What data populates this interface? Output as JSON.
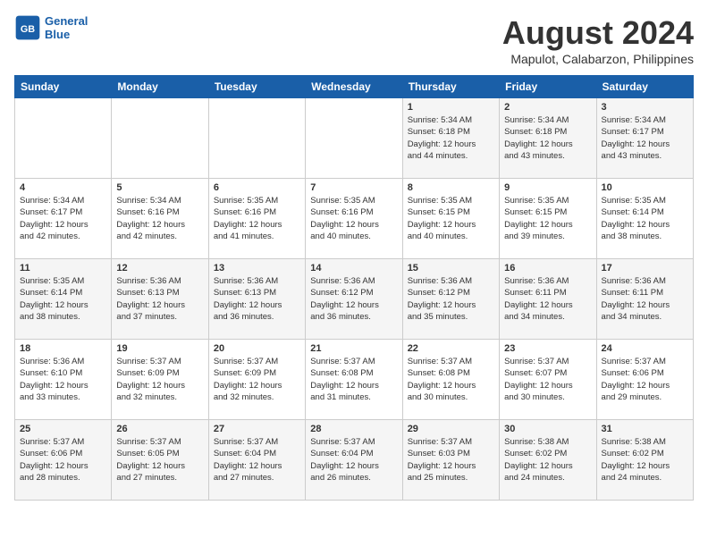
{
  "header": {
    "logo_line1": "General",
    "logo_line2": "Blue",
    "month_title": "August 2024",
    "location": "Mapulot, Calabarzon, Philippines"
  },
  "days_of_week": [
    "Sunday",
    "Monday",
    "Tuesday",
    "Wednesday",
    "Thursday",
    "Friday",
    "Saturday"
  ],
  "weeks": [
    [
      {
        "day": "",
        "text": ""
      },
      {
        "day": "",
        "text": ""
      },
      {
        "day": "",
        "text": ""
      },
      {
        "day": "",
        "text": ""
      },
      {
        "day": "1",
        "text": "Sunrise: 5:34 AM\nSunset: 6:18 PM\nDaylight: 12 hours\nand 44 minutes."
      },
      {
        "day": "2",
        "text": "Sunrise: 5:34 AM\nSunset: 6:18 PM\nDaylight: 12 hours\nand 43 minutes."
      },
      {
        "day": "3",
        "text": "Sunrise: 5:34 AM\nSunset: 6:17 PM\nDaylight: 12 hours\nand 43 minutes."
      }
    ],
    [
      {
        "day": "4",
        "text": "Sunrise: 5:34 AM\nSunset: 6:17 PM\nDaylight: 12 hours\nand 42 minutes."
      },
      {
        "day": "5",
        "text": "Sunrise: 5:34 AM\nSunset: 6:16 PM\nDaylight: 12 hours\nand 42 minutes."
      },
      {
        "day": "6",
        "text": "Sunrise: 5:35 AM\nSunset: 6:16 PM\nDaylight: 12 hours\nand 41 minutes."
      },
      {
        "day": "7",
        "text": "Sunrise: 5:35 AM\nSunset: 6:16 PM\nDaylight: 12 hours\nand 40 minutes."
      },
      {
        "day": "8",
        "text": "Sunrise: 5:35 AM\nSunset: 6:15 PM\nDaylight: 12 hours\nand 40 minutes."
      },
      {
        "day": "9",
        "text": "Sunrise: 5:35 AM\nSunset: 6:15 PM\nDaylight: 12 hours\nand 39 minutes."
      },
      {
        "day": "10",
        "text": "Sunrise: 5:35 AM\nSunset: 6:14 PM\nDaylight: 12 hours\nand 38 minutes."
      }
    ],
    [
      {
        "day": "11",
        "text": "Sunrise: 5:35 AM\nSunset: 6:14 PM\nDaylight: 12 hours\nand 38 minutes."
      },
      {
        "day": "12",
        "text": "Sunrise: 5:36 AM\nSunset: 6:13 PM\nDaylight: 12 hours\nand 37 minutes."
      },
      {
        "day": "13",
        "text": "Sunrise: 5:36 AM\nSunset: 6:13 PM\nDaylight: 12 hours\nand 36 minutes."
      },
      {
        "day": "14",
        "text": "Sunrise: 5:36 AM\nSunset: 6:12 PM\nDaylight: 12 hours\nand 36 minutes."
      },
      {
        "day": "15",
        "text": "Sunrise: 5:36 AM\nSunset: 6:12 PM\nDaylight: 12 hours\nand 35 minutes."
      },
      {
        "day": "16",
        "text": "Sunrise: 5:36 AM\nSunset: 6:11 PM\nDaylight: 12 hours\nand 34 minutes."
      },
      {
        "day": "17",
        "text": "Sunrise: 5:36 AM\nSunset: 6:11 PM\nDaylight: 12 hours\nand 34 minutes."
      }
    ],
    [
      {
        "day": "18",
        "text": "Sunrise: 5:36 AM\nSunset: 6:10 PM\nDaylight: 12 hours\nand 33 minutes."
      },
      {
        "day": "19",
        "text": "Sunrise: 5:37 AM\nSunset: 6:09 PM\nDaylight: 12 hours\nand 32 minutes."
      },
      {
        "day": "20",
        "text": "Sunrise: 5:37 AM\nSunset: 6:09 PM\nDaylight: 12 hours\nand 32 minutes."
      },
      {
        "day": "21",
        "text": "Sunrise: 5:37 AM\nSunset: 6:08 PM\nDaylight: 12 hours\nand 31 minutes."
      },
      {
        "day": "22",
        "text": "Sunrise: 5:37 AM\nSunset: 6:08 PM\nDaylight: 12 hours\nand 30 minutes."
      },
      {
        "day": "23",
        "text": "Sunrise: 5:37 AM\nSunset: 6:07 PM\nDaylight: 12 hours\nand 30 minutes."
      },
      {
        "day": "24",
        "text": "Sunrise: 5:37 AM\nSunset: 6:06 PM\nDaylight: 12 hours\nand 29 minutes."
      }
    ],
    [
      {
        "day": "25",
        "text": "Sunrise: 5:37 AM\nSunset: 6:06 PM\nDaylight: 12 hours\nand 28 minutes."
      },
      {
        "day": "26",
        "text": "Sunrise: 5:37 AM\nSunset: 6:05 PM\nDaylight: 12 hours\nand 27 minutes."
      },
      {
        "day": "27",
        "text": "Sunrise: 5:37 AM\nSunset: 6:04 PM\nDaylight: 12 hours\nand 27 minutes."
      },
      {
        "day": "28",
        "text": "Sunrise: 5:37 AM\nSunset: 6:04 PM\nDaylight: 12 hours\nand 26 minutes."
      },
      {
        "day": "29",
        "text": "Sunrise: 5:37 AM\nSunset: 6:03 PM\nDaylight: 12 hours\nand 25 minutes."
      },
      {
        "day": "30",
        "text": "Sunrise: 5:38 AM\nSunset: 6:02 PM\nDaylight: 12 hours\nand 24 minutes."
      },
      {
        "day": "31",
        "text": "Sunrise: 5:38 AM\nSunset: 6:02 PM\nDaylight: 12 hours\nand 24 minutes."
      }
    ]
  ]
}
